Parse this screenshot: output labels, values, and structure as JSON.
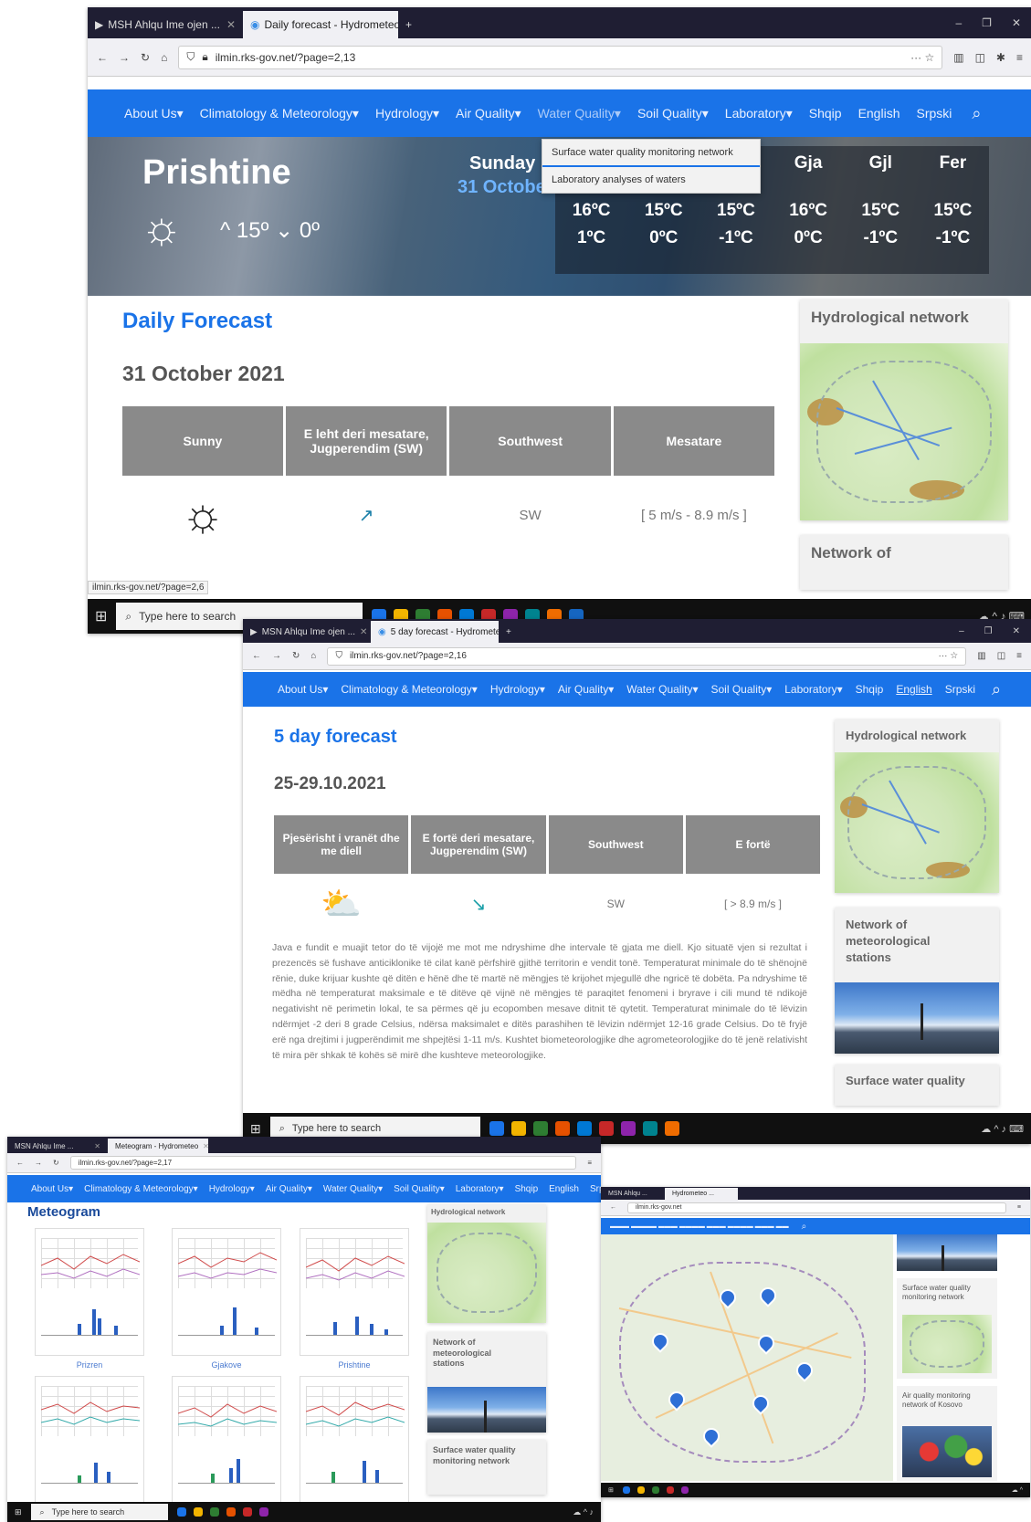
{
  "s1": {
    "tabs": [
      {
        "title": "MSH Ahlqu Ime ojen ..."
      },
      {
        "title": "Daily forecast - Hydrometeo"
      }
    ],
    "url": "ilmin.rks-gov.net/?page=2,13",
    "nav": [
      "About Us▾",
      "Climatology & Meteorology▾",
      "Hydrology▾",
      "Air Quality▾",
      "Water Quality▾",
      "Soil Quality▾",
      "Laboratory▾",
      "Shqip",
      "English",
      "Srpski"
    ],
    "dropdown": [
      "Surface water quality monitoring network",
      "Laboratory analyses of waters"
    ],
    "banner": {
      "city": "Prishtine",
      "hi": "^ 15º",
      "lo": "⌄ 0º",
      "today": "Sunday",
      "today_date": "31 October",
      "days": [
        {
          "d": "",
          "hi": "16ºC",
          "lo": "1ºC"
        },
        {
          "d": "",
          "hi": "15ºC",
          "lo": "0ºC"
        },
        {
          "d": "",
          "hi": "15ºC",
          "lo": "-1ºC"
        },
        {
          "d": "Gja",
          "hi": "16ºC",
          "lo": "0ºC"
        },
        {
          "d": "Gjl",
          "hi": "15ºC",
          "lo": "-1ºC"
        },
        {
          "d": "Fer",
          "hi": "15ºC",
          "lo": "-1ºC"
        }
      ]
    },
    "title": "Daily Forecast",
    "date": "31 October 2021",
    "table": {
      "headers": [
        "Sunny",
        "E leht deri mesatare, Jugperendim (SW)",
        "Southwest",
        "Mesatare"
      ],
      "row": {
        "icon": "☼",
        "arrow": "↗",
        "dir": "SW",
        "wind": "[ 5 m/s - 8.9 m/s ]"
      }
    },
    "side": [
      "Hydrological network",
      "Network of"
    ],
    "status": "ilmin.rks-gov.net/?page=2,6",
    "taskbar_search": "Type here to search"
  },
  "s2": {
    "tabs": [
      {
        "title": "MSN Ahlqu Ime ojen ..."
      },
      {
        "title": "5 day forecast - Hydrometeo"
      }
    ],
    "url": "ilmin.rks-gov.net/?page=2,16",
    "nav": [
      "About Us▾",
      "Climatology & Meteorology▾",
      "Hydrology▾",
      "Air Quality▾",
      "Water Quality▾",
      "Soil Quality▾",
      "Laboratory▾",
      "Shqip",
      "English",
      "Srpski"
    ],
    "title": "5 day forecast",
    "date": "25-29.10.2021",
    "table": {
      "headers": [
        "Pjesërisht i vranët dhe me diell",
        "E fortë deri mesatare, Jugperendim (SW)",
        "Southwest",
        "E fortë"
      ],
      "row": {
        "icon": "⛅",
        "arrow": "↘",
        "dir": "SW",
        "wind": "[ > 8.9 m/s ]"
      }
    },
    "paragraph": "Java e fundit e muajit tetor do të vijojë me mot me ndryshime dhe intervale të gjata me diell. Kjo situatë vjen si rezultat i prezencës së fushave anticiklonike të cilat kanë përfshirë gjithë territorin e vendit tonë. Temperaturat minimale do të shënojnë rënie, duke krijuar kushte që ditën e hënë dhe të martë në mëngjes të krijohet mjegullë dhe ngricë të dobëta. Pa ndryshime të mëdha në temperaturat maksimale e të ditëve që vijnë në mëngjes të paraqitet fenomeni i bryrave i cili mund të ndikojë negativisht në perimetin lokal, te sa përmes që ju ecopomben mesave ditnit të qytetit. Temperaturat minimale do të lëvizin ndërmjet -2 deri 8 grade Celsius, ndërsa maksimalet e ditës parashihen të lëvizin ndërmjet 12-16 grade Celsius. Do të fryjë erë nga drejtimi i jugperëndimit me shpejtësi 1-11 m/s. Kushtet biometeorologjike dhe agrometeorologjike do të jenë relativisht të mira për shkak të kohës së mirë dhe kushteve meteorologjike.",
    "side": [
      "Hydrological network",
      "Network of meteorological stations",
      "Surface water quality"
    ],
    "taskbar_search": "Type here to search"
  },
  "s3": {
    "tabs": [
      {
        "title": "MSN Ahlqu Ime ..."
      },
      {
        "title": "Meteogram - Hydrometeo"
      }
    ],
    "url": "ilmin.rks-gov.net/?page=2,17",
    "nav": [
      "About Us▾",
      "Climatology & Meteorology▾",
      "Hydrology▾",
      "Air Quality▾",
      "Water Quality▾",
      "Soil Quality▾",
      "Laboratory▾",
      "Shqip",
      "English",
      "Srpski"
    ],
    "title": "Meteogram",
    "grams": [
      {
        "label": "Prizren"
      },
      {
        "label": "Gjakove"
      },
      {
        "label": "Prishtine"
      },
      {
        "label": ""
      },
      {
        "label": ""
      },
      {
        "label": ""
      }
    ],
    "side": [
      "Hydrological network",
      "Network of meteorological stations",
      "Surface water quality monitoring network"
    ],
    "taskbar_search": "Type here to search"
  },
  "s4": {
    "tabs": [
      {
        "title": "MSN Ahlqu ..."
      },
      {
        "title": "Hydrometeo ..."
      }
    ],
    "url": "ilmin.rks-gov.net",
    "side": [
      "Surface water quality monitoring network",
      "Air quality monitoring network of Kosovo"
    ]
  }
}
